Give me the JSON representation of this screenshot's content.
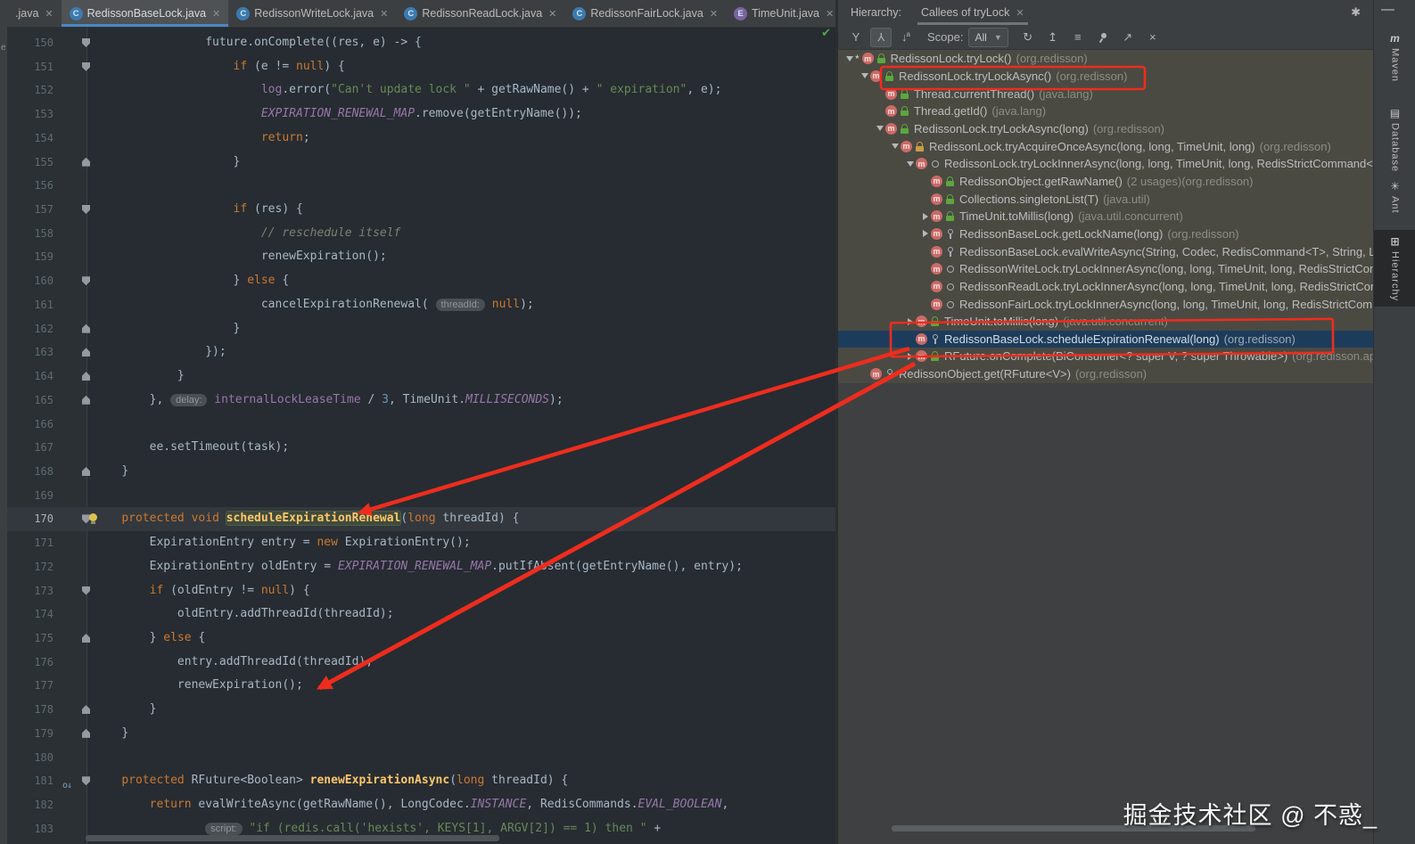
{
  "left_strip": {
    "partial_char": "e"
  },
  "tabs": {
    "items": [
      {
        "label": ".java",
        "icon": null,
        "active": false
      },
      {
        "label": "RedissonBaseLock.java",
        "icon": "C",
        "active": true
      },
      {
        "label": "RedissonWriteLock.java",
        "icon": "C",
        "active": false
      },
      {
        "label": "RedissonReadLock.java",
        "icon": "C",
        "active": false
      },
      {
        "label": "RedissonFairLock.java",
        "icon": "C",
        "active": false
      },
      {
        "label": "TimeUnit.java",
        "icon": "E",
        "active": false
      }
    ],
    "overflow_icon": "chevron-down"
  },
  "editor": {
    "first_line": 150,
    "inspection_status": "no-problems-check",
    "lines": [
      {
        "n": 150,
        "ind": 16,
        "fold": "down",
        "segs": [
          [
            "d",
            "future.onComplete((res, e) -> {"
          ]
        ]
      },
      {
        "n": 151,
        "ind": 20,
        "fold": "down",
        "segs": [
          [
            "k",
            "if"
          ],
          [
            "d",
            " (e != "
          ],
          [
            "k",
            "null"
          ],
          [
            "d",
            ") {"
          ]
        ]
      },
      {
        "n": 152,
        "ind": 24,
        "segs": [
          [
            "f",
            "log"
          ],
          [
            "d",
            ".error("
          ],
          [
            "s",
            "\"Can't update lock \""
          ],
          [
            "d",
            " + getRawName() + "
          ],
          [
            "s",
            "\" expiration\""
          ],
          [
            "d",
            ", e);"
          ]
        ]
      },
      {
        "n": 153,
        "ind": 24,
        "segs": [
          [
            "sf",
            "EXPIRATION_RENEWAL_MAP"
          ],
          [
            "d",
            ".remove(getEntryName());"
          ]
        ]
      },
      {
        "n": 154,
        "ind": 24,
        "segs": [
          [
            "k",
            "return"
          ],
          [
            "d",
            ";"
          ]
        ]
      },
      {
        "n": 155,
        "ind": 20,
        "fold": "up",
        "segs": [
          [
            "d",
            "}"
          ]
        ]
      },
      {
        "n": 156,
        "ind": 0,
        "segs": []
      },
      {
        "n": 157,
        "ind": 20,
        "fold": "down",
        "segs": [
          [
            "k",
            "if"
          ],
          [
            "d",
            " (res) {"
          ]
        ]
      },
      {
        "n": 158,
        "ind": 24,
        "segs": [
          [
            "c",
            "// reschedule itself"
          ]
        ]
      },
      {
        "n": 159,
        "ind": 24,
        "segs": [
          [
            "d",
            "renewExpiration();"
          ]
        ]
      },
      {
        "n": 160,
        "ind": 20,
        "fold": "down",
        "segs": [
          [
            "d",
            "} "
          ],
          [
            "k",
            "else"
          ],
          [
            "d",
            " {"
          ]
        ]
      },
      {
        "n": 161,
        "ind": 24,
        "segs": [
          [
            "d",
            "cancelExpirationRenewal( "
          ],
          [
            "h",
            "threadId:"
          ],
          [
            "d",
            " "
          ],
          [
            "k",
            "null"
          ],
          [
            "d",
            ");"
          ]
        ]
      },
      {
        "n": 162,
        "ind": 20,
        "fold": "up",
        "segs": [
          [
            "d",
            "}"
          ]
        ]
      },
      {
        "n": 163,
        "ind": 16,
        "fold": "up",
        "segs": [
          [
            "d",
            "});"
          ]
        ]
      },
      {
        "n": 164,
        "ind": 12,
        "fold": "up",
        "segs": [
          [
            "d",
            "}"
          ]
        ]
      },
      {
        "n": 165,
        "ind": 8,
        "fold": "up",
        "segs": [
          [
            "d",
            "}, "
          ],
          [
            "h",
            "delay:"
          ],
          [
            "d",
            " "
          ],
          [
            "f",
            "internalLockLeaseTime"
          ],
          [
            "d",
            " / "
          ],
          [
            "n",
            "3"
          ],
          [
            "d",
            ", TimeUnit."
          ],
          [
            "sf",
            "MILLISECONDS"
          ],
          [
            "d",
            ");"
          ]
        ]
      },
      {
        "n": 166,
        "ind": 0,
        "segs": []
      },
      {
        "n": 167,
        "ind": 8,
        "segs": [
          [
            "d",
            "ee.setTimeout(task);"
          ]
        ]
      },
      {
        "n": 168,
        "ind": 4,
        "fold": "up",
        "segs": [
          [
            "d",
            "}"
          ]
        ]
      },
      {
        "n": 169,
        "ind": 0,
        "segs": []
      },
      {
        "n": 170,
        "ind": 4,
        "fold": "down",
        "bulb": true,
        "cur": true,
        "segs": [
          [
            "k",
            "protected"
          ],
          [
            "d",
            " "
          ],
          [
            "k",
            "void"
          ],
          [
            "d",
            " "
          ],
          [
            "mh",
            "scheduleExpirationRenewal"
          ],
          [
            "d",
            "("
          ],
          [
            "k",
            "long"
          ],
          [
            "d",
            " threadId) {"
          ]
        ]
      },
      {
        "n": 171,
        "ind": 8,
        "segs": [
          [
            "d",
            "ExpirationEntry entry = "
          ],
          [
            "k",
            "new"
          ],
          [
            "d",
            " ExpirationEntry();"
          ]
        ]
      },
      {
        "n": 172,
        "ind": 8,
        "segs": [
          [
            "d",
            "ExpirationEntry oldEntry = "
          ],
          [
            "sf",
            "EXPIRATION_RENEWAL_MAP"
          ],
          [
            "d",
            ".putIfAbsent(getEntryName(), entry);"
          ]
        ]
      },
      {
        "n": 173,
        "ind": 8,
        "fold": "down",
        "segs": [
          [
            "k",
            "if"
          ],
          [
            "d",
            " (oldEntry != "
          ],
          [
            "k",
            "null"
          ],
          [
            "d",
            ") {"
          ]
        ]
      },
      {
        "n": 174,
        "ind": 12,
        "segs": [
          [
            "d",
            "oldEntry.addThreadId(threadId);"
          ]
        ]
      },
      {
        "n": 175,
        "ind": 8,
        "fold": "up",
        "segs": [
          [
            "d",
            "} "
          ],
          [
            "k",
            "else"
          ],
          [
            "d",
            " {"
          ]
        ]
      },
      {
        "n": 176,
        "ind": 12,
        "segs": [
          [
            "d",
            "entry.addThreadId(threadId);"
          ]
        ]
      },
      {
        "n": 177,
        "ind": 12,
        "segs": [
          [
            "d",
            "renewExpiration();"
          ]
        ]
      },
      {
        "n": 178,
        "ind": 8,
        "fold": "up",
        "segs": [
          [
            "d",
            "}"
          ]
        ]
      },
      {
        "n": 179,
        "ind": 4,
        "fold": "up",
        "segs": [
          [
            "d",
            "}"
          ]
        ]
      },
      {
        "n": 180,
        "ind": 0,
        "segs": []
      },
      {
        "n": 181,
        "ind": 4,
        "fold": "down",
        "ovr": true,
        "segs": [
          [
            "k",
            "protected"
          ],
          [
            "d",
            " RFuture<Boolean> "
          ],
          [
            "m",
            "renewExpirationAsync"
          ],
          [
            "d",
            "("
          ],
          [
            "k",
            "long"
          ],
          [
            "d",
            " threadId) {"
          ]
        ]
      },
      {
        "n": 182,
        "ind": 8,
        "segs": [
          [
            "k",
            "return"
          ],
          [
            "d",
            " evalWriteAsync(getRawName(), LongCodec."
          ],
          [
            "sf",
            "INSTANCE"
          ],
          [
            "d",
            ", RedisCommands."
          ],
          [
            "sf",
            "EVAL_BOOLEAN"
          ],
          [
            "d",
            ","
          ]
        ]
      },
      {
        "n": 183,
        "ind": 16,
        "segs": [
          [
            "h",
            "script:"
          ],
          [
            "d",
            " "
          ],
          [
            "s",
            "\"if (redis.call('hexists', KEYS[1], ARGV[2]) == 1) then \""
          ],
          [
            "d",
            " +"
          ]
        ]
      }
    ]
  },
  "hierarchy": {
    "title": "Hierarchy:",
    "tab": "Callees of tryLock",
    "toolbar": {
      "scope_label": "Scope:",
      "scope_value": "All",
      "icons": [
        "caller-hierarchy",
        "callee-hierarchy",
        "sort-alphabetically",
        "refresh",
        "expand-all",
        "collapse-all",
        "pin",
        "open-in-new-window",
        "close"
      ]
    },
    "tree": [
      {
        "ind": 0,
        "exp": "open",
        "star": true,
        "vis": "green",
        "name": "RedissonLock.tryLock()",
        "pkg": "(org.redisson)"
      },
      {
        "ind": 1,
        "exp": "open",
        "vis": "green",
        "name": "RedissonLock.tryLockAsync()",
        "pkg": "(org.redisson)"
      },
      {
        "ind": 2,
        "vis": "green",
        "name": "Thread.currentThread()",
        "pkg": "(java.lang)"
      },
      {
        "ind": 2,
        "vis": "green",
        "name": "Thread.getId()",
        "pkg": "(java.lang)"
      },
      {
        "ind": 2,
        "exp": "open",
        "vis": "green",
        "name": "RedissonLock.tryLockAsync(long)",
        "pkg": "(org.redisson)"
      },
      {
        "ind": 3,
        "exp": "open",
        "vis": "orange",
        "name": "RedissonLock.tryAcquireOnceAsync(long, long, TimeUnit, long)",
        "pkg": "(org.redisson)"
      },
      {
        "ind": 4,
        "exp": "open",
        "vis": "circle",
        "name": "RedissonLock.tryLockInnerAsync(long, long, TimeUnit, long, RedisStrictCommand<T>",
        "pkg": ""
      },
      {
        "ind": 5,
        "vis": "green",
        "name": "RedissonObject.getRawName()",
        "usages": "(2 usages)",
        "pkg": "(org.redisson)"
      },
      {
        "ind": 5,
        "vis": "green",
        "name": "Collections.singletonList(T)",
        "pkg": "(java.util)"
      },
      {
        "ind": 5,
        "exp": "closed",
        "vis": "green",
        "name": "TimeUnit.toMillis(long)",
        "pkg": "(java.util.concurrent)"
      },
      {
        "ind": 5,
        "exp": "closed",
        "vis": "key",
        "name": "RedissonBaseLock.getLockName(long)",
        "pkg": "(org.redisson)"
      },
      {
        "ind": 5,
        "vis": "key",
        "name": "RedissonBaseLock.evalWriteAsync(String, Codec, RedisCommand<T>, String, List",
        "pkg": ""
      },
      {
        "ind": 5,
        "vis": "circle",
        "name": "RedissonWriteLock.tryLockInnerAsync(long, long, TimeUnit, long, RedisStrictComm",
        "pkg": ""
      },
      {
        "ind": 5,
        "vis": "circle",
        "name": "RedissonReadLock.tryLockInnerAsync(long, long, TimeUnit, long, RedisStrictComm",
        "pkg": ""
      },
      {
        "ind": 5,
        "vis": "circle",
        "name": "RedissonFairLock.tryLockInnerAsync(long, long, TimeUnit, long, RedisStrictComma",
        "pkg": ""
      },
      {
        "ind": 4,
        "exp": "closed",
        "vis": "green",
        "name": "TimeUnit.toMillis(long)",
        "pkg": "(java.util.concurrent)"
      },
      {
        "ind": 4,
        "vis": "key",
        "sel": true,
        "name": "RedissonBaseLock.scheduleExpirationRenewal(long)",
        "pkg": "(org.redisson)"
      },
      {
        "ind": 4,
        "exp": "closed",
        "vis": "green",
        "name": "RFuture.onComplete(BiConsumer<? super V, ? super Throwable>)",
        "pkg": "(org.redisson.api"
      },
      {
        "ind": 1,
        "vis": "key",
        "name": "RedissonObject.get(RFuture<V>)",
        "pkg": "(org.redisson)"
      }
    ]
  },
  "stripe": {
    "minimize_label": "—",
    "items": [
      {
        "label": "Maven",
        "icon": "maven-icon",
        "active": false
      },
      {
        "label": "Database",
        "icon": "database-icon",
        "active": false
      },
      {
        "label": "Ant",
        "icon": "ant-icon",
        "active": false
      },
      {
        "label": "Hierarchy",
        "icon": "hierarchy-icon",
        "active": true
      }
    ]
  },
  "watermark": {
    "text": "掘金技术社区 @ 不惑_"
  },
  "colors": {
    "annotation_red": "#ee2c1e",
    "selection_blue": "#1d3c5c",
    "tab_underline": "#4a88c7",
    "editor_bg": "#262c31",
    "panel_bg": "#3c3f41",
    "tree_bg": "#4a4a43"
  }
}
